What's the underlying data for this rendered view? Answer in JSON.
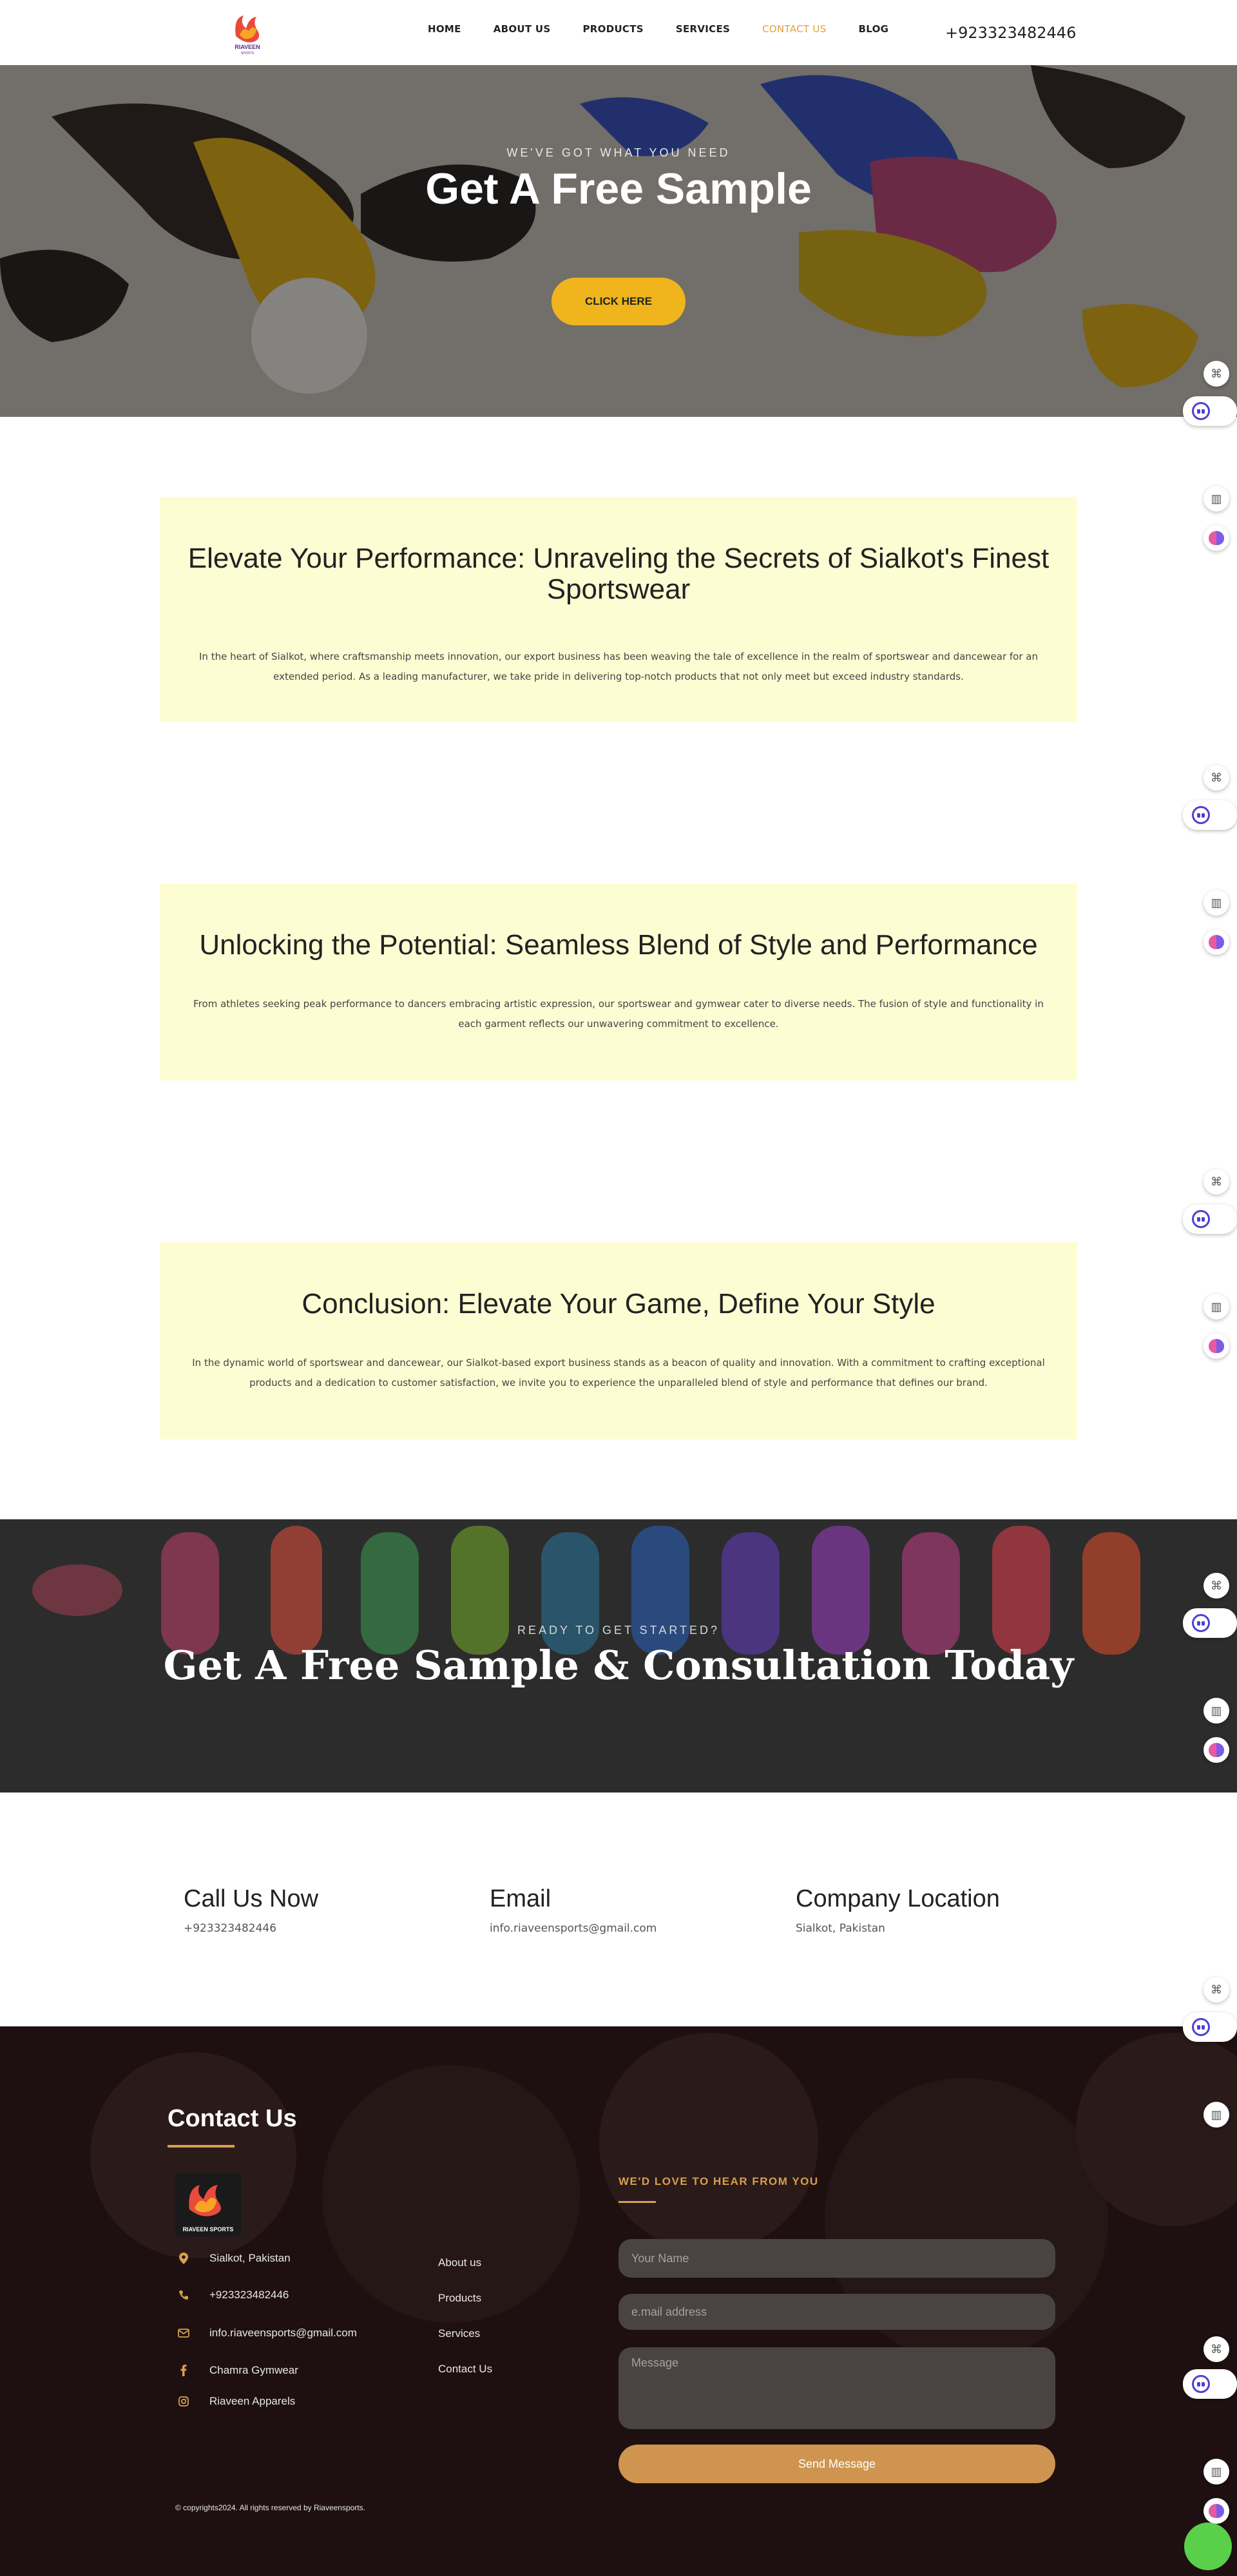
{
  "header": {
    "nav": [
      "HOME",
      "ABOUT US",
      "PRODUCTS",
      "SERVICES",
      "CONTACT US",
      "BLOG"
    ],
    "active_nav": "CONTACT US",
    "phone": "+923323482446"
  },
  "hero": {
    "kicker": "WE'VE GOT WHAT YOU NEED",
    "title": "Get A Free Sample",
    "cta": "CLICK HERE"
  },
  "sections": [
    {
      "heading": "Elevate Your Performance: Unraveling the Secrets of Sialkot's Finest Sportswear",
      "body": "In the heart of Sialkot, where craftsmanship meets innovation, our export business has been weaving the tale of excellence in the realm of sportswear and dancewear for an extended period. As a leading manufacturer, we take pride in delivering top-notch products that not only meet but exceed industry standards."
    },
    {
      "heading": "Unlocking the Potential: Seamless Blend of Style and Performance",
      "body": "From athletes seeking peak performance to dancers embracing artistic expression, our sportswear and gymwear cater to diverse needs. The fusion of style and functionality in each garment reflects our unwavering commitment to excellence."
    },
    {
      "heading": "Conclusion: Elevate Your Game, Define Your Style",
      "body": "In the dynamic world of sportswear and dancewear, our Sialkot-based export business stands as a beacon of quality and innovation. With a commitment to crafting exceptional products and a dedication to customer satisfaction, we invite you to experience the unparalleled blend of style and performance that defines our brand."
    }
  ],
  "band": {
    "kicker": "READY TO GET STARTED?",
    "title": "Get A Free Sample & Consultation Today"
  },
  "contact_info": [
    {
      "heading": "Call Us Now",
      "value": "+923323482446"
    },
    {
      "heading": "Email",
      "value": "info.riaveensports@gmail.com"
    },
    {
      "heading": "Company Location",
      "value": "Sialkot, Pakistan"
    }
  ],
  "footer": {
    "title": "Contact Us",
    "logo_text": "RIAVEEN SPORTS",
    "items": [
      {
        "icon": "map-pin-icon",
        "text": "Sialkot, Pakistan"
      },
      {
        "icon": "phone-icon",
        "text": "+923323482446"
      },
      {
        "icon": "email-icon",
        "text": "info.riaveensports@gmail.com"
      },
      {
        "icon": "facebook-icon",
        "text": "Chamra Gymwear"
      },
      {
        "icon": "instagram-icon",
        "text": "Riaveen Apparels"
      }
    ],
    "links": [
      "About us",
      "Products",
      "Services",
      "Contact Us"
    ],
    "form": {
      "kicker": "WE'D LOVE TO HEAR FROM YOU",
      "name_placeholder": "Your Name",
      "email_placeholder": "e.mail address",
      "message_placeholder": "Message",
      "send": "Send Message"
    },
    "copyright": "© copyrights2024.  All rights reserved by Riaveensports."
  },
  "colors": {
    "accent": "#f0b51d",
    "nav_active": "#e3a137",
    "card_bg": "#fdfdd3",
    "footer_bg": "#1e1010",
    "footer_accent": "#d89f4e"
  }
}
